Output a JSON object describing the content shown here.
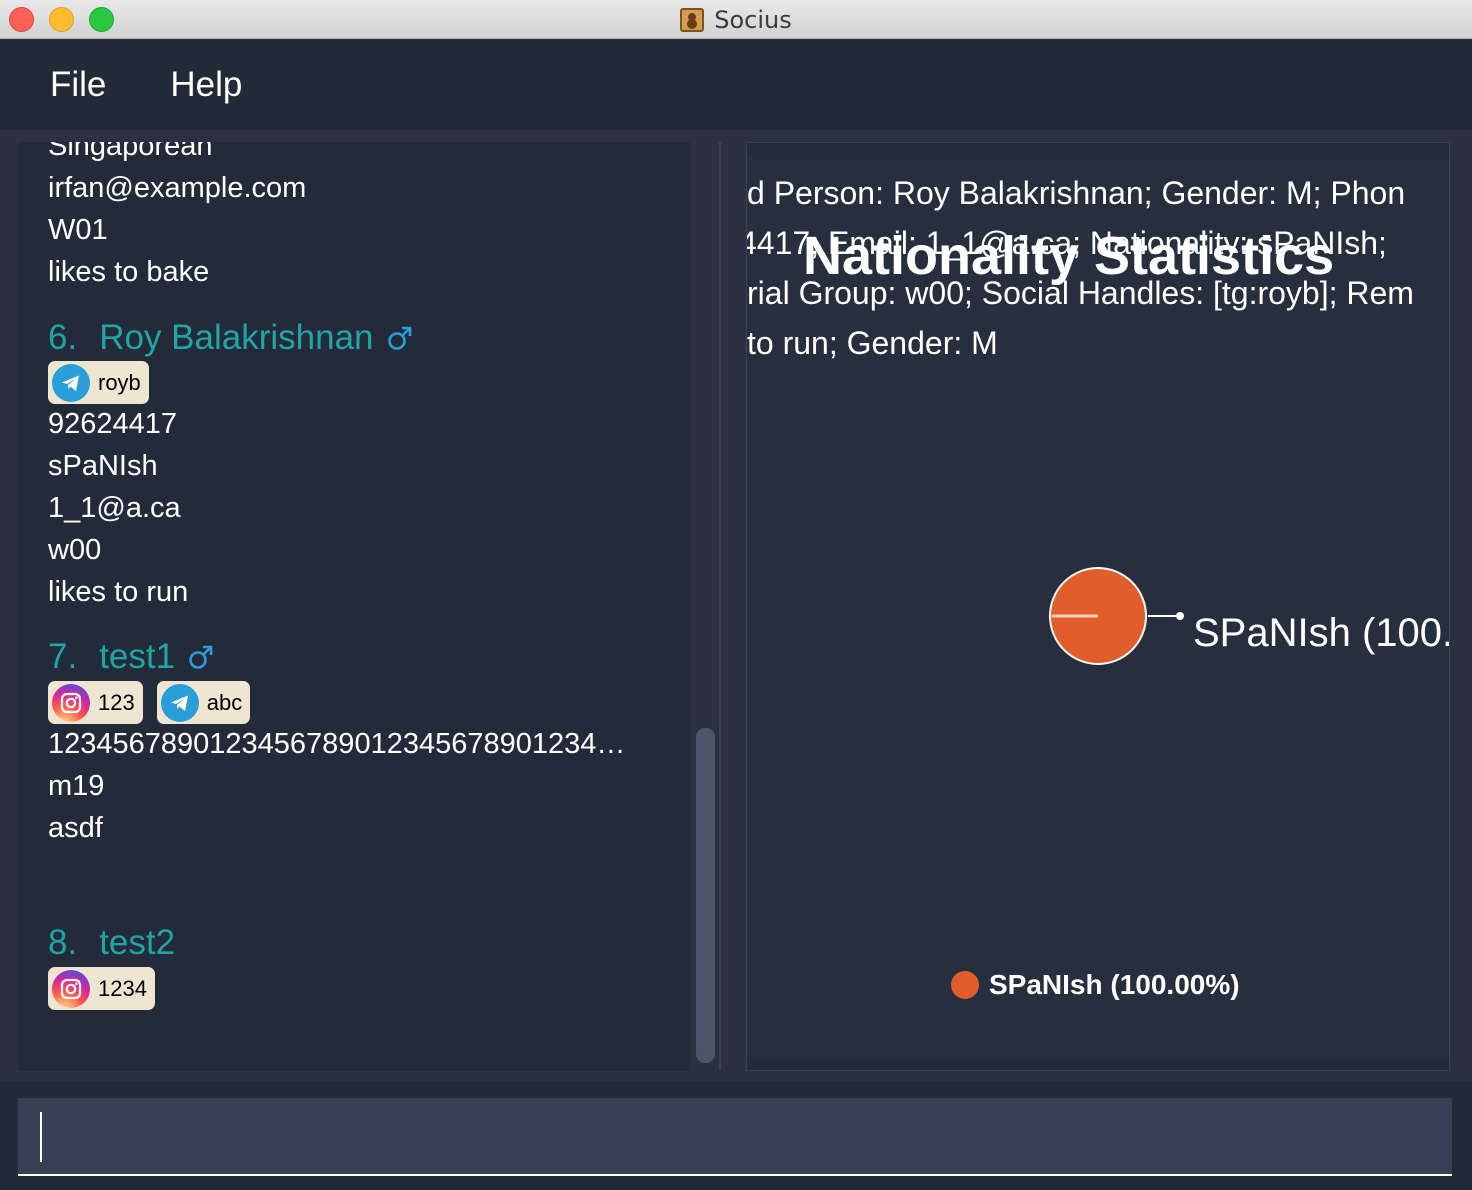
{
  "window": {
    "title": "Socius"
  },
  "menu": {
    "file": "File",
    "help": "Help"
  },
  "persons": {
    "prev": {
      "nationality": "Singaporean",
      "email": "irfan@example.com",
      "tutorial_group": "W01",
      "remark": "likes to bake"
    },
    "p6": {
      "index": "6.",
      "name": "Roy Balakrishnan",
      "gender_icon": "male-icon",
      "tags": [
        {
          "icon": "telegram-icon",
          "handle": "royb"
        }
      ],
      "phone": "92624417",
      "nationality": "sPaNIsh",
      "email": "1_1@a.ca",
      "tutorial_group": "w00",
      "remark": "likes to run"
    },
    "p7": {
      "index": "7.",
      "name": "test1",
      "gender_icon": "male-icon",
      "tags": [
        {
          "icon": "instagram-icon",
          "handle": "123"
        },
        {
          "icon": "telegram-icon",
          "handle": "abc"
        }
      ],
      "phone": "1234567890123456789012345678901234…",
      "tutorial_group": "m19",
      "remark": "asdf"
    },
    "p8": {
      "index": "8.",
      "name": "test2",
      "tags": [
        {
          "icon": "instagram-icon",
          "handle": "1234"
        }
      ]
    }
  },
  "result_lines": [
    "d Person: Roy Balakrishnan; Gender: M; Phon",
    "4417; Email: 1_1@a.ca; Nationality: sPaNIsh;",
    "rial Group: w00; Social Handles: [tg:royb]; Rem",
    "to run; Gender: M"
  ],
  "chart_data": {
    "type": "pie",
    "title": "Nationality Statistics",
    "slices": [
      {
        "label": "SPaNIsh",
        "value": 100.0,
        "label_text": "SPaNIsh (100.",
        "legend_text": "SPaNIsh (100.00%)"
      }
    ],
    "colors": [
      "#e25d2c"
    ],
    "legend_position": "bottom"
  },
  "command": {
    "value": ""
  }
}
